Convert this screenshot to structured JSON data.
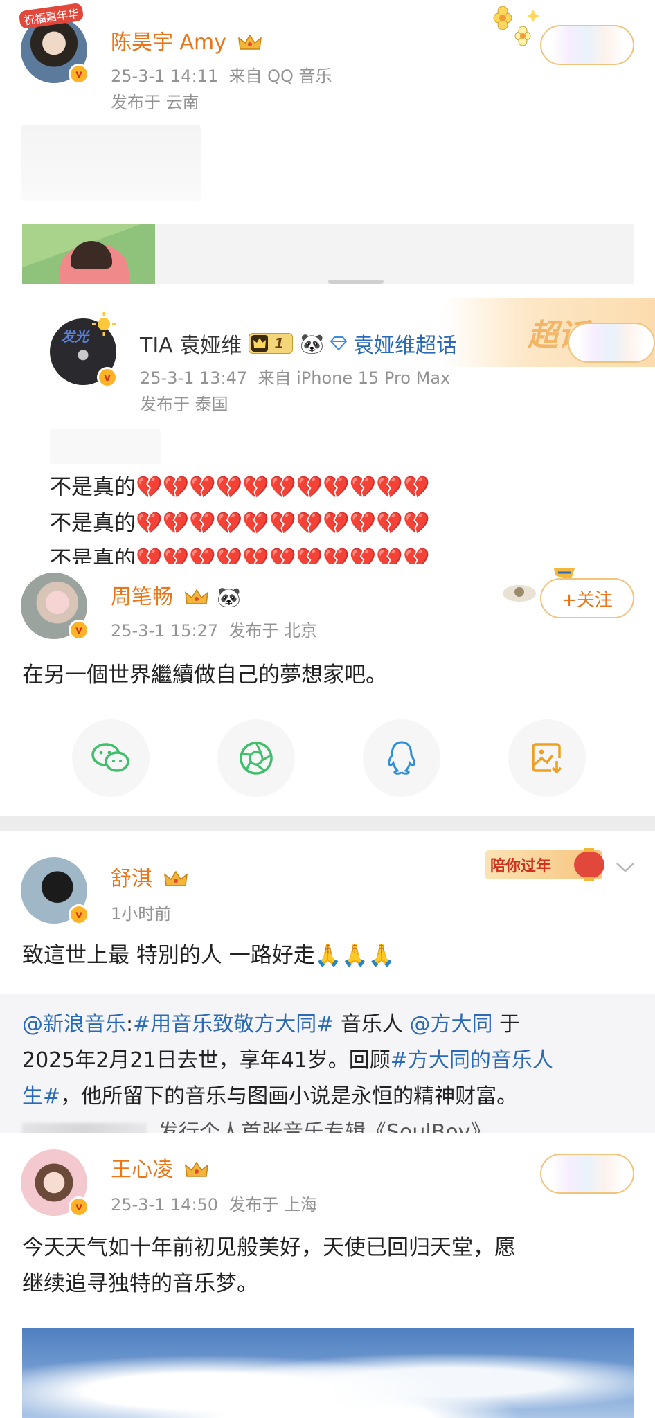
{
  "posts": [
    {
      "user": "陈昊宇 Amy",
      "time": "25-3-1 14:11",
      "source": "来自 QQ 音乐",
      "location": "发布于 云南",
      "avatar_badge": "祝福嘉年华"
    },
    {
      "user": "TIA 袁娅维",
      "level": "1",
      "supertopic": "袁娅维超话",
      "banner": "超话",
      "time": "25-3-1 13:47",
      "source": "来自 iPhone 15 Pro Max",
      "location": "发布于 泰国",
      "avatar_text": "发光",
      "lines": [
        "不是真的💔💔💔💔💔💔💔💔💔💔💔",
        "不是真的💔💔💔💔💔💔💔💔💔💔💔",
        "不是真的💔💔💔💔💔💔💔💔💔💔💔"
      ]
    },
    {
      "user": "周笔畅",
      "time": "25-3-1 15:27",
      "location": "发布于 北京",
      "follow": "+关注",
      "text": "在另一個世界繼續做自己的夢想家吧。"
    },
    {
      "user": "舒淇",
      "time": "1小时前",
      "badge": "陪你过年",
      "text": "致這世上最 特別的人 一路好走🙏🙏🙏",
      "repost_mention1": "@新浪音乐",
      "repost_topic1": "#用音乐致敬方大同#",
      "repost_t1": " 音乐人 ",
      "repost_mention2": "@方大同",
      "repost_t2": " 于",
      "repost_line2": "2025年2月21日去世，享年41岁。回顾",
      "repost_topic2a": "#方大同的音乐人",
      "repost_topic2b": "生#",
      "repost_line3": "，他所留下的音乐与图画小说是永恒的精神财富。",
      "repost_line4": "发行个人首张音乐专辑《SoulBoy》，"
    },
    {
      "user": "王心凌",
      "time": "25-3-1 14:50",
      "location": "发布于 上海",
      "text_line1": "今天天气如十年前初见般美好，天使已回归天堂，愿",
      "text_line2": "继续追寻独特的音乐梦。"
    }
  ],
  "share_icons": [
    "wechat-icon",
    "moments-icon",
    "qq-icon",
    "save-image-icon"
  ],
  "colors": {
    "username_orange": "#e8761a",
    "link_blue": "#2a6ab8",
    "meta_gray": "#939393",
    "share_green": "#3fbf6c",
    "share_blue": "#2f8fd8",
    "share_orange": "#f0a020"
  }
}
